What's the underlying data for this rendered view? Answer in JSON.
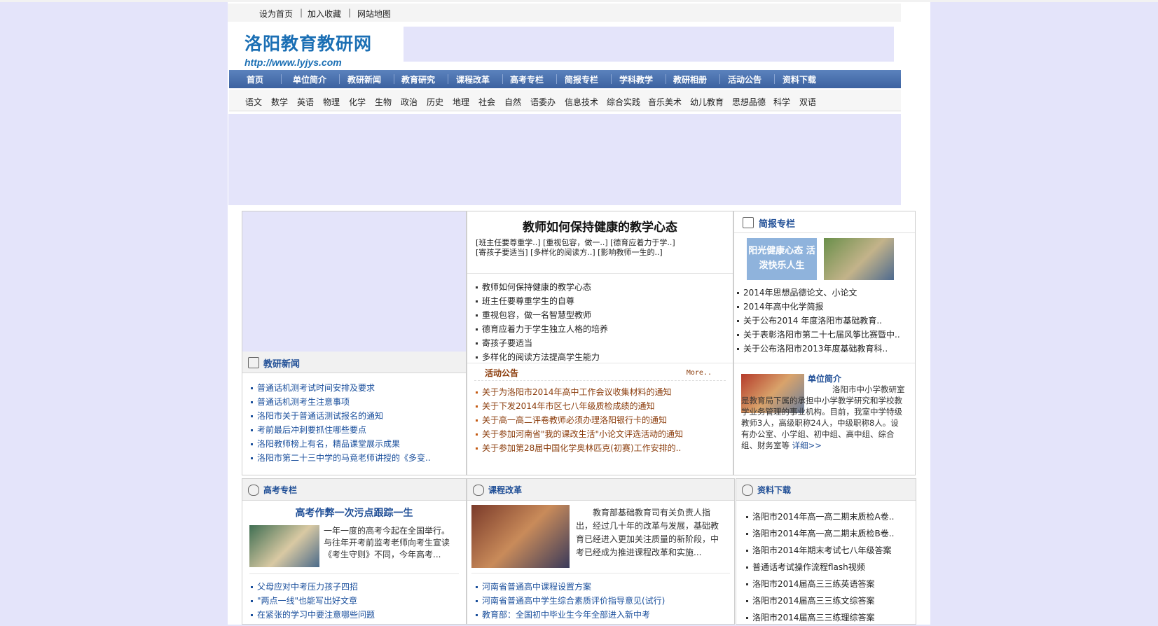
{
  "toplinks": {
    "home": "设为首页",
    "sep1": "|",
    "fav": "加入收藏",
    "sep2": "|",
    "map": "网站地图"
  },
  "logo": {
    "cn": "洛阳教育教研网",
    "url": "http://www.lyjys.com"
  },
  "mainnav": [
    "首页",
    "单位简介",
    "教研新闻",
    "教育研究",
    "课程改革",
    "高考专栏",
    "简报专栏",
    "学科教学",
    "教研相册",
    "活动公告",
    "资料下载"
  ],
  "subnav": [
    "语文",
    "数学",
    "英语",
    "物理",
    "化学",
    "生物",
    "政治",
    "历史",
    "地理",
    "社会",
    "自然",
    "语委办",
    "信息技术",
    "综合实践",
    "音乐美术",
    "幼儿教育",
    "思想品德",
    "科学",
    "双语"
  ],
  "headline": {
    "title": "教师如何保持健康的教学心态",
    "links_line1": "[班主任要尊重学..] [重视包容，做一..] [德育应着力于学..]",
    "links_line2": "[寄孩子要适当] [多样化的阅读方..] [影响教师一生的..]"
  },
  "center_list": [
    "教师如何保持健康的教学心态",
    "班主任要尊重学生的自尊",
    "重视包容，做一名智慧型教师",
    "德育应着力于学生独立人格的培养",
    "寄孩子要适当",
    "多样化的阅读方法提高学生能力"
  ],
  "briefing": {
    "title": "简报专栏",
    "img_text": "阳光健康心态 活泼快乐人生",
    "items": [
      "2014年思想品德论文、小论文",
      "2014年高中化学简报",
      "关于公布2014 年度洛阳市基础教育..",
      "关于表彰洛阳市第二十七届风筝比赛暨中..",
      "关于公布洛阳市2013年度基础教育科.."
    ]
  },
  "research_news": {
    "title": "教研新闻",
    "items": [
      "普通话机测考试时间安排及要求",
      "普通话机测考生注意事项",
      "洛阳市关于普通话测试报名的通知",
      "考前最后冲刺要抓住哪些要点",
      "洛阳教师榜上有名，精品课堂展示成果",
      "洛阳市第二十三中学的马竟老师讲授的《多变.."
    ]
  },
  "activity": {
    "title": "活动公告",
    "more": "More..",
    "items": [
      "关于为洛阳市2014年高中工作会议收集材料的通知",
      "关于下发2014年市区七八年级质检成绩的通知",
      "关于高一高二评卷教师必须办理洛阳银行卡的通知",
      "关于参加河南省\"我的课改生活\"小论文评选活动的通知",
      "关于参加第28届中国化学奥林匹克(初赛)工作安排的.."
    ]
  },
  "unit_intro": {
    "title": "单位简介",
    "text": "洛阳市中小学教研室是教育局下属的承担中小学教学研究和学校教学业务管理的事业机构。目前，我室中学特级教师3人，高级职称24人，中级职称8人。设有办公室、小学组、初中组、高中组、综合组、财务室等",
    "more": "详细>>"
  },
  "gaokao": {
    "title": "高考专栏",
    "headline": "高考作弊一次污点跟踪一生",
    "summary": "一年一度的高考今起在全国举行。与往年开考前监考老师向考生宣读《考生守则》不同，今年高考...",
    "items": [
      "父母应对中考压力孩子四招",
      "\"两点一线\"也能写出好文章",
      "在紧张的学习中要注意哪些问题"
    ]
  },
  "curriculum": {
    "title": "课程改革",
    "summary": "教育部基础教育司有关负责人指出，经过几十年的改革与发展，基础教育已经进入更加关注质量的新阶段，中考已经成为推进课程改革和实施...",
    "items": [
      "河南省普通高中课程设置方案",
      "河南省普通高中学生综合素质评价指导意见(试行)",
      "教育部：全国初中毕业生今年全部进入新中考"
    ]
  },
  "downloads": {
    "title": "资料下载",
    "items": [
      "洛阳市2014年高一高二期末质检A卷..",
      "洛阳市2014年高一高二期末质检B卷..",
      "洛阳市2014年期末考试七八年级答案",
      "普通话考试操作流程flash视频",
      "洛阳市2014届高三三练英语答案",
      "洛阳市2014届高三三练文综答案",
      "洛阳市2014届高三三练理综答案"
    ]
  },
  "colors": {
    "nav": "#3c62a0",
    "link": "#1a4f9c",
    "notice": "#8a3b0a",
    "placeholder": "#e4e4fa"
  }
}
